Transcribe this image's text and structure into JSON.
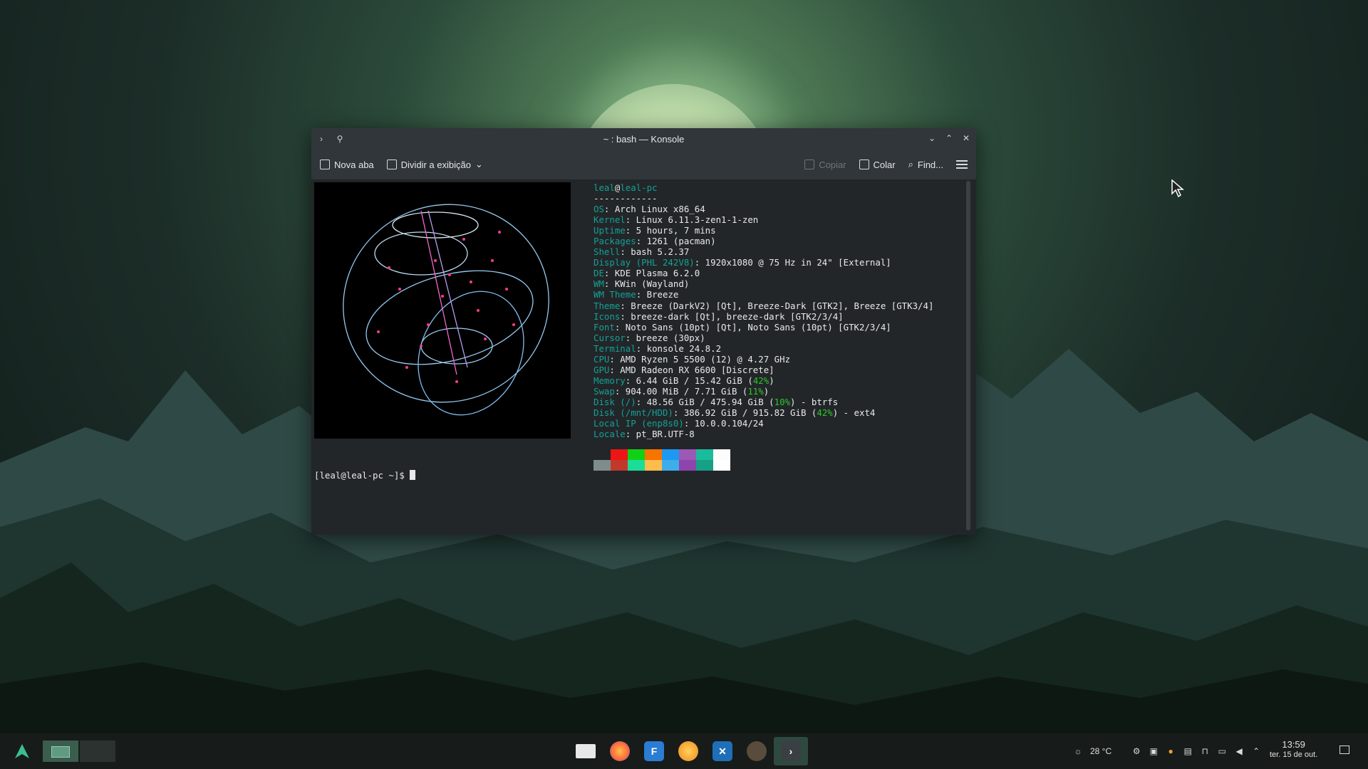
{
  "window": {
    "title": "~ : bash — Konsole"
  },
  "toolbar": {
    "new_tab": "Nova aba",
    "split_view": "Dividir a exibição",
    "copy": "Copiar",
    "paste": "Colar",
    "find": "Find..."
  },
  "terminal": {
    "user": "leal",
    "at": "@",
    "host": "leal-pc",
    "separator": "------------",
    "info": [
      {
        "key": "OS",
        "value": ": Arch Linux x86_64"
      },
      {
        "key": "Kernel",
        "value": ": Linux 6.11.3-zen1-1-zen"
      },
      {
        "key": "Uptime",
        "value": ": 5 hours, 7 mins"
      },
      {
        "key": "Packages",
        "value": ": 1261 (pacman)"
      },
      {
        "key": "Shell",
        "value": ": bash 5.2.37"
      },
      {
        "key": "Display (PHL 242V8)",
        "value": ": 1920x1080 @ 75 Hz in 24\" [External]"
      },
      {
        "key": "DE",
        "value": ": KDE Plasma 6.2.0"
      },
      {
        "key": "WM",
        "value": ": KWin (Wayland)"
      },
      {
        "key": "WM Theme",
        "value": ": Breeze"
      },
      {
        "key": "Theme",
        "value": ": Breeze (DarkV2) [Qt], Breeze-Dark [GTK2], Breeze [GTK3/4]"
      },
      {
        "key": "Icons",
        "value": ": breeze-dark [Qt], breeze-dark [GTK2/3/4]"
      },
      {
        "key": "Font",
        "value": ": Noto Sans (10pt) [Qt], Noto Sans (10pt) [GTK2/3/4]"
      },
      {
        "key": "Cursor",
        "value": ": breeze (30px)"
      },
      {
        "key": "Terminal",
        "value": ": konsole 24.8.2"
      },
      {
        "key": "CPU",
        "value": ": AMD Ryzen 5 5500 (12) @ 4.27 GHz"
      },
      {
        "key": "GPU",
        "value": ": AMD Radeon RX 6600 [Discrete]"
      }
    ],
    "memory": {
      "key": "Memory",
      "value": ": 6.44 GiB / 15.42 GiB (",
      "pct": "42%",
      "tail": ")"
    },
    "swap": {
      "key": "Swap",
      "value": ": 904.00 MiB / 7.71 GiB (",
      "pct": "11%",
      "tail": ")"
    },
    "disk_root": {
      "key": "Disk (/)",
      "value": ": 48.56 GiB / 475.94 GiB (",
      "pct": "10%",
      "tail": ") - btrfs"
    },
    "disk_hdd": {
      "key": "Disk (/mnt/HDD)",
      "value": ": 386.92 GiB / 915.82 GiB (",
      "pct": "42%",
      "tail": ") - ext4"
    },
    "local_ip": {
      "key": "Local IP (enp8s0)",
      "value": ": 10.0.0.104/24"
    },
    "locale": {
      "key": "Locale",
      "value": ": pt_BR.UTF-8"
    },
    "prompt": "[leal@leal-pc ~]$ ",
    "palette_top": [
      "#232629",
      "#ed1515",
      "#11d116",
      "#f67400",
      "#1d99f3",
      "#9b59b6",
      "#1abc9c",
      "#fcfcfc"
    ],
    "palette_bottom": [
      "#7f8c8d",
      "#c0392b",
      "#1cdc9a",
      "#fdbc4b",
      "#3daee9",
      "#8e44ad",
      "#16a085",
      "#ffffff"
    ]
  },
  "taskbar": {
    "weather": "28 °C",
    "time": "13:59",
    "date": "ter. 15 de out."
  },
  "colors": {
    "accent": "#14a195",
    "good": "#29c72b"
  }
}
